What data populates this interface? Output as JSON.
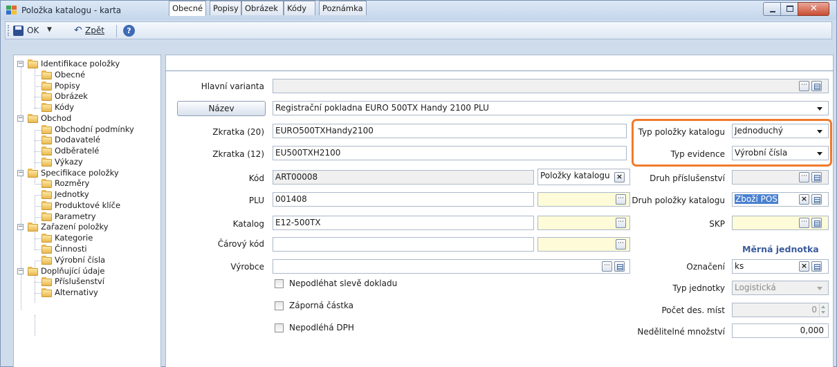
{
  "window": {
    "title": "Položka katalogu - karta",
    "controls": {
      "minimize": "minimize",
      "maximize": "maximize",
      "close": "close"
    }
  },
  "toolbar": {
    "ok_label": "OK",
    "back_label": "Zpět",
    "icons": {
      "save": "save-icon",
      "undo": "undo-icon",
      "help": "help-icon"
    }
  },
  "tree": {
    "items": [
      {
        "label": "Identifikace položky",
        "level": 0
      },
      {
        "label": "Obecné",
        "level": 1
      },
      {
        "label": "Popisy",
        "level": 1
      },
      {
        "label": "Obrázek",
        "level": 1
      },
      {
        "label": "Kódy",
        "level": 1
      },
      {
        "label": "Obchod",
        "level": 0
      },
      {
        "label": "Obchodní podmínky",
        "level": 1
      },
      {
        "label": "Dodavatelé",
        "level": 1
      },
      {
        "label": "Odběratelé",
        "level": 1
      },
      {
        "label": "Výkazy",
        "level": 1
      },
      {
        "label": "Specifikace položky",
        "level": 0
      },
      {
        "label": "Rozměry",
        "level": 1
      },
      {
        "label": "Jednotky",
        "level": 1
      },
      {
        "label": "Produktové klíče",
        "level": 1
      },
      {
        "label": "Parametry",
        "level": 1
      },
      {
        "label": "Zařazení položky",
        "level": 0
      },
      {
        "label": "Kategorie",
        "level": 1
      },
      {
        "label": "Činnosti",
        "level": 1
      },
      {
        "label": "Výrobní čísla",
        "level": 1
      },
      {
        "label": "Doplňující údaje",
        "level": 0
      },
      {
        "label": "Příslušenství",
        "level": 1
      },
      {
        "label": "Alternativy",
        "level": 1
      }
    ]
  },
  "tabs": [
    "Obecné",
    "Popisy",
    "Obrázek",
    "Kódy",
    "Poznámka"
  ],
  "form": {
    "hlavni_varianta": {
      "label": "Hlavní varianta",
      "value": ""
    },
    "nazev": {
      "button": "Název",
      "value": "Registrační pokladna EURO 500TX Handy 2100 PLU"
    },
    "zkratka20": {
      "label": "Zkratka (20)",
      "value": "EURO500TXHandy2100"
    },
    "zkratka12": {
      "label": "Zkratka (12)",
      "value": "EU500TXH2100"
    },
    "kod": {
      "label": "Kód",
      "value": "ART00008",
      "tag": "Položky katalogu"
    },
    "plu": {
      "label": "PLU",
      "value": "001408"
    },
    "katalog": {
      "label": "Katalog",
      "value": "E12-500TX"
    },
    "carovy_kod": {
      "label": "Čárový kód",
      "value": ""
    },
    "vyrobce": {
      "label": "Výrobce",
      "value": ""
    },
    "checkboxes": {
      "sleva": "Nepodléhat slevě dokladu",
      "zaporna": "Záporná částka",
      "dph": "Nepodléhá DPH"
    }
  },
  "right": {
    "typ_polozky": {
      "label": "Typ položky katalogu",
      "value": "Jednoduchý"
    },
    "typ_evidence": {
      "label": "Typ evidence",
      "value": "Výrobní čísla"
    },
    "druh_prislusenstvi": {
      "label": "Druh příslušenství",
      "value": ""
    },
    "druh_polozky": {
      "label": "Druh položky katalogu",
      "value": "Zboží POS"
    },
    "skp": {
      "label": "SKP",
      "value": ""
    },
    "merna_jednotka": {
      "title": "Měrná jednotka",
      "oznaceni": {
        "label": "Označení",
        "value": "ks"
      },
      "typ_jednotky": {
        "label": "Typ jednotky",
        "value": "Logistická"
      },
      "pocet_des_mist": {
        "label": "Počet des. míst",
        "value": "0"
      },
      "nedelitelne": {
        "label": "Nedělitelné množství",
        "value": "0,000"
      }
    }
  },
  "colors": {
    "highlight": "#f07a2a",
    "accent": "#3a5b9a",
    "readonly_yellow": "#fdfbd8"
  }
}
